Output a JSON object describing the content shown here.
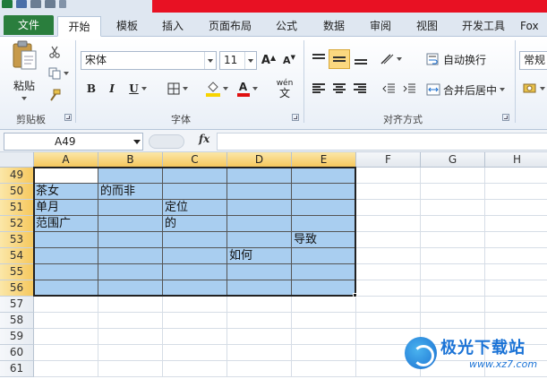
{
  "ribbon_tabs": {
    "file": "文件",
    "home": "开始",
    "template": "模板",
    "insert": "插入",
    "page_layout": "页面布局",
    "formulas": "公式",
    "data": "数据",
    "review": "审阅",
    "view": "视图",
    "developer": "开发工具",
    "foxit": "Fox"
  },
  "clipboard": {
    "paste": "粘贴",
    "group_label": "剪贴板",
    "paste_icon": "paste-icon",
    "cut_icon": "scissors-icon",
    "copy_icon": "copy-icon",
    "format_painter_icon": "format-painter-icon"
  },
  "font": {
    "name": "宋体",
    "size": "11",
    "bold": "B",
    "italic": "I",
    "underline": "U",
    "font_color": "A",
    "wen": "wén",
    "phonetic": "文",
    "grow": "A",
    "shrink": "A",
    "group_label": "字体",
    "highlight_color": "#f7d400",
    "font_color_value": "#e01010"
  },
  "alignment": {
    "wrap_text": "自动换行",
    "merge_center": "合并后居中",
    "group_label": "对齐方式"
  },
  "number": {
    "format": "常规"
  },
  "formula_bar": {
    "name_box": "A49",
    "fx": "fx",
    "formula": ""
  },
  "sheet": {
    "columns": [
      "A",
      "B",
      "C",
      "D",
      "E",
      "F",
      "G",
      "H"
    ],
    "rows": [
      {
        "row": "49",
        "cells": [
          "",
          "",
          "",
          "",
          "",
          "",
          "",
          ""
        ]
      },
      {
        "row": "50",
        "cells": [
          "茶女",
          "  的而非",
          "",
          "",
          "",
          "",
          "",
          ""
        ]
      },
      {
        "row": "51",
        "cells": [
          "单月",
          "",
          "定位",
          "",
          "",
          "",
          "",
          ""
        ]
      },
      {
        "row": "52",
        "cells": [
          "范围广",
          "",
          "的",
          "",
          "",
          "",
          "",
          ""
        ]
      },
      {
        "row": "53",
        "cells": [
          "",
          "",
          "",
          "",
          "导致",
          "",
          "",
          ""
        ]
      },
      {
        "row": "54",
        "cells": [
          "",
          "",
          "",
          "如何",
          "",
          "",
          "",
          ""
        ]
      },
      {
        "row": "55",
        "cells": [
          "",
          "",
          "",
          "",
          "",
          "",
          "",
          ""
        ]
      },
      {
        "row": "56",
        "cells": [
          "",
          "",
          "",
          "",
          "",
          "",
          "",
          ""
        ]
      },
      {
        "row": "57",
        "cells": [
          "",
          "",
          "",
          "",
          "",
          "",
          "",
          ""
        ]
      },
      {
        "row": "58",
        "cells": [
          "",
          "",
          "",
          "",
          "",
          "",
          "",
          ""
        ]
      },
      {
        "row": "59",
        "cells": [
          "",
          "",
          "",
          "",
          "",
          "",
          "",
          ""
        ]
      },
      {
        "row": "60",
        "cells": [
          "",
          "",
          "",
          "",
          "",
          "",
          "",
          ""
        ]
      },
      {
        "row": "61",
        "cells": [
          "",
          "",
          "",
          "",
          "",
          "",
          "",
          ""
        ]
      }
    ],
    "selection": {
      "start": "A49",
      "end": "E56"
    },
    "selection_color": "#a9cef0"
  },
  "watermark": {
    "brand": "极光下载站",
    "url": "www.xz7.com"
  }
}
